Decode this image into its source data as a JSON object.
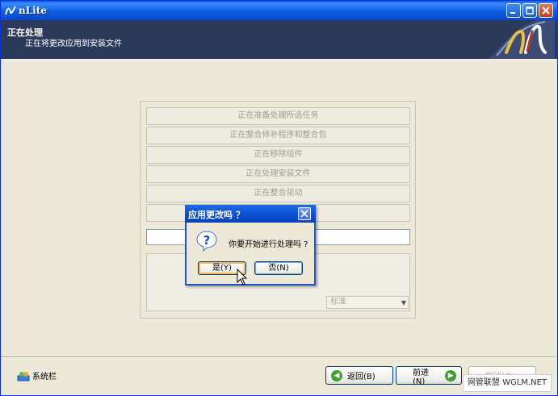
{
  "window": {
    "title": "nLite"
  },
  "header": {
    "title": "正在处理",
    "subtitle": "正在将更改应用到安装文件"
  },
  "tasks": [
    {
      "label": "正在准备处理所选任务"
    },
    {
      "label": "正在整合修补程序和整合包"
    },
    {
      "label": "正在移除组件"
    },
    {
      "label": "正在处理安装文件"
    },
    {
      "label": "正在整合驱动"
    }
  ],
  "priority_combo": {
    "value": "标准"
  },
  "footer": {
    "tray_label": "系统栏",
    "back_label": "返回(B)",
    "next_label": "前进(N)",
    "cancel_label": "取消(C)",
    "watermark": "网管联盟 WGLM.NET"
  },
  "dialog": {
    "title": "应用更改吗 ？",
    "message": "你要开始进行处理吗 ?",
    "yes_label": "是(Y)",
    "no_label": "否(N)"
  },
  "colors": {
    "titlebar": "#0b5fe0",
    "header_bg": "#2c3a5a",
    "window_bg": "#ece9d8",
    "accent_green": "#3fa036"
  }
}
